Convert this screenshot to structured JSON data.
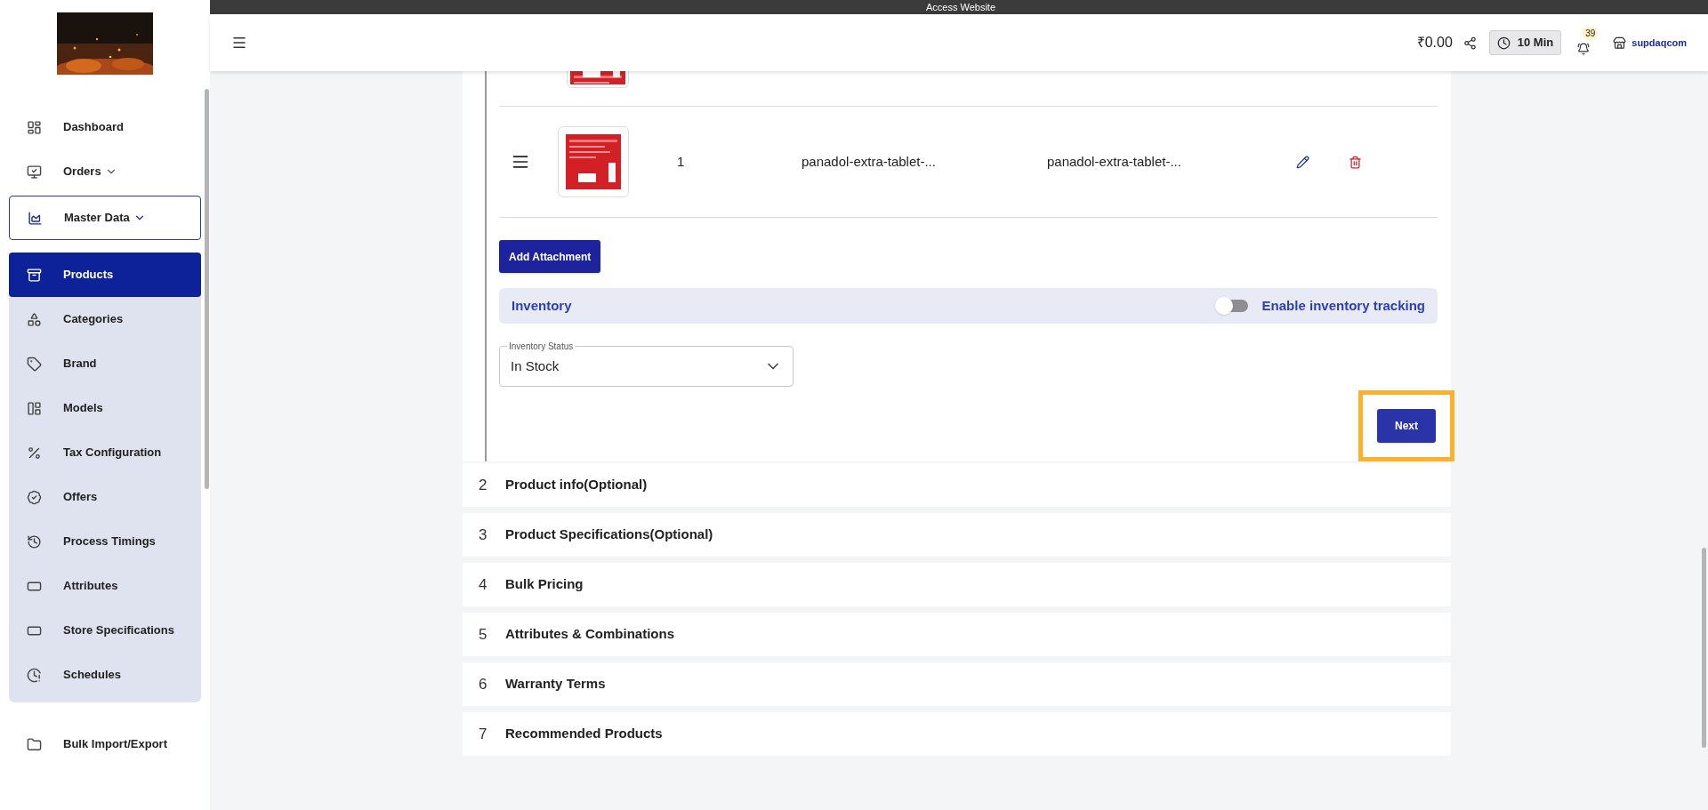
{
  "top_strip": {
    "title": "Access Website"
  },
  "header": {
    "balance": "₹0.00",
    "timer": "10 Min",
    "notification_count": "39",
    "store": "supdaqcom"
  },
  "sidebar": {
    "items": [
      {
        "label": "Dashboard",
        "selected": false
      },
      {
        "label": "Orders",
        "selected": false,
        "expanded": false
      },
      {
        "label": "Master Data",
        "selected": false,
        "expanded": true,
        "children": [
          {
            "label": "Products",
            "selected": true
          },
          {
            "label": "Categories",
            "selected": false
          },
          {
            "label": "Brand",
            "selected": false
          },
          {
            "label": "Models",
            "selected": false
          },
          {
            "label": "Tax Configuration",
            "selected": false
          },
          {
            "label": "Offers",
            "selected": false
          },
          {
            "label": "Process Timings",
            "selected": false
          },
          {
            "label": "Attributes",
            "selected": false
          },
          {
            "label": "Store Specifications",
            "selected": false
          },
          {
            "label": "Schedules",
            "selected": false
          }
        ]
      },
      {
        "label": "Bulk Import/Export",
        "selected": false
      }
    ]
  },
  "attachments": {
    "rows": [
      {
        "column_3": "1",
        "column_4": "panadol-extra-tablet-...",
        "column_5": "panadol-extra-tablet-..."
      }
    ],
    "add_button": "Add Attachment"
  },
  "inventory": {
    "title": "Inventory",
    "tracking": {
      "label": "Enable inventory tracking",
      "on": false
    },
    "status": {
      "label": "Inventory Status",
      "value": "In Stock"
    }
  },
  "next_button": {
    "label": "Next",
    "highlighted": true
  },
  "steps": [
    {
      "number": "2",
      "title": "Product info(Optional)"
    },
    {
      "number": "3",
      "title": "Product Specifications(Optional)"
    },
    {
      "number": "4",
      "title": "Bulk Pricing"
    },
    {
      "number": "5",
      "title": "Attributes & Combinations"
    },
    {
      "number": "6",
      "title": "Warranty Terms"
    },
    {
      "number": "7",
      "title": "Recommended Products"
    }
  ]
}
